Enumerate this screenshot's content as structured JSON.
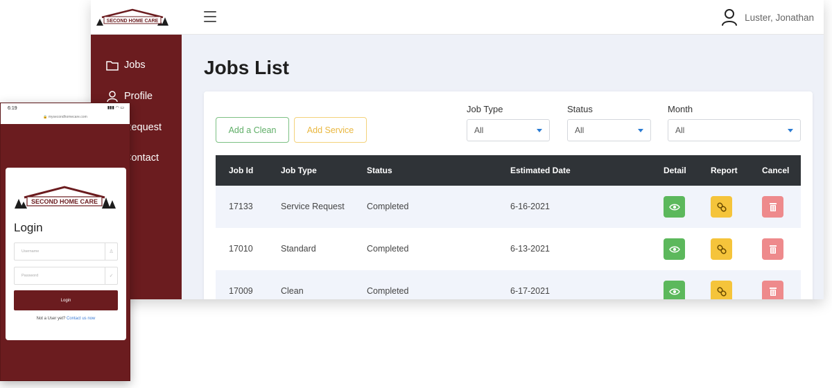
{
  "app": {
    "brand": "SECOND HOME CARE"
  },
  "header": {
    "user_name": "Luster, Jonathan",
    "menu_icon": "hamburger-menu-icon",
    "user_icon": "user-icon"
  },
  "sidebar": {
    "items": [
      {
        "label": "Jobs",
        "icon": "folder-icon"
      },
      {
        "label": "Profile",
        "icon": "user-icon"
      },
      {
        "label": "Request",
        "icon": "request-icon"
      },
      {
        "label": "Contact",
        "icon": "contact-icon"
      }
    ]
  },
  "main": {
    "title": "Jobs List",
    "buttons": {
      "add_clean": "Add a Clean",
      "add_service": "Add Service"
    },
    "filters": [
      {
        "label": "Job Type",
        "value": "All"
      },
      {
        "label": "Status",
        "value": "All"
      },
      {
        "label": "Month",
        "value": "All"
      }
    ],
    "table": {
      "headers": [
        "Job Id",
        "Job Type",
        "Status",
        "Estimated Date",
        "Detail",
        "Report",
        "Cancel"
      ],
      "rows": [
        {
          "job_id": "17133",
          "job_type": "Service Request",
          "status": "Completed",
          "date": "6-16-2021"
        },
        {
          "job_id": "17010",
          "job_type": "Standard",
          "status": "Completed",
          "date": "6-13-2021"
        },
        {
          "job_id": "17009",
          "job_type": "Clean",
          "status": "Completed",
          "date": "6-17-2021"
        }
      ]
    }
  },
  "colors": {
    "sidebar": "#6b1c1f",
    "detail": "#5cb85c",
    "report": "#f5c43b",
    "cancel": "#ee8a8c",
    "table_header": "#2f3337"
  },
  "phone": {
    "time": "6:19",
    "url": "mysecondhomecare.com",
    "login_title": "Login",
    "username_placeholder": "Username",
    "password_placeholder": "Password",
    "login_button": "Login",
    "footer_text": "Not a User yet?",
    "footer_link": "Contact us now"
  }
}
